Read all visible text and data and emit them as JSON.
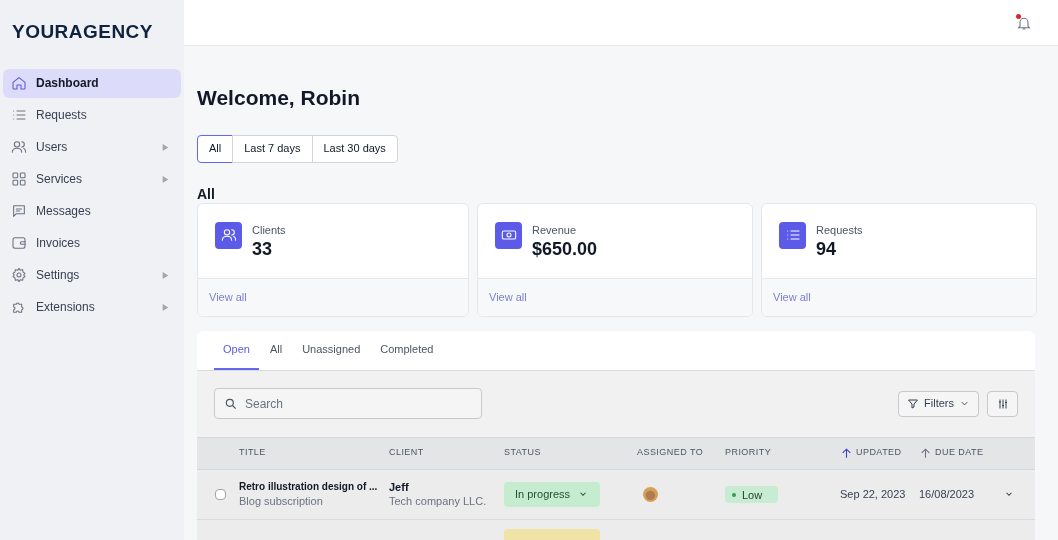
{
  "sidebar": {
    "logo": "YOURAGENCY",
    "items": [
      {
        "label": "Dashboard",
        "selected": true,
        "submenu": false
      },
      {
        "label": "Requests",
        "selected": false,
        "submenu": false
      },
      {
        "label": "Users",
        "selected": false,
        "submenu": true
      },
      {
        "label": "Services",
        "selected": false,
        "submenu": true
      },
      {
        "label": "Messages",
        "selected": false,
        "submenu": false
      },
      {
        "label": "Invoices",
        "selected": false,
        "submenu": false
      },
      {
        "label": "Settings",
        "selected": false,
        "submenu": true
      },
      {
        "label": "Extensions",
        "selected": false,
        "submenu": true
      }
    ]
  },
  "header": {
    "notification": true
  },
  "title": "Welcome, Robin",
  "ranges": [
    {
      "label": "All",
      "selected": true
    },
    {
      "label": "Last 7 days",
      "selected": false
    },
    {
      "label": "Last 30 days",
      "selected": false
    }
  ],
  "section_title": "All",
  "stats": [
    {
      "label": "Clients",
      "value": "33",
      "link": "View all"
    },
    {
      "label": "Revenue",
      "value": "$650.00",
      "link": "View all"
    },
    {
      "label": "Requests",
      "value": "94",
      "link": "View all"
    }
  ],
  "tabs": [
    {
      "label": "Open",
      "selected": true
    },
    {
      "label": "All",
      "selected": false
    },
    {
      "label": "Unassigned",
      "selected": false
    },
    {
      "label": "Completed",
      "selected": false
    }
  ],
  "search": {
    "placeholder": "Search"
  },
  "filters_button": "Filters",
  "table": {
    "columns": [
      {
        "label": "TITLE"
      },
      {
        "label": "CLIENT"
      },
      {
        "label": "STATUS"
      },
      {
        "label": "ASSIGNED TO"
      },
      {
        "label": "PRIORITY"
      },
      {
        "label": "UPDATED",
        "sorted": true
      },
      {
        "label": "DUE DATE",
        "sorted": false
      }
    ],
    "rows": [
      {
        "title": "Retro illustration design of ...",
        "subtitle": "Blog subscription",
        "client": "Jeff",
        "company": "Tech company LLC.",
        "status": "In progress",
        "color": "#c6ecd0",
        "checked": false,
        "priority": "Low",
        "updated": "Sep 22, 2023",
        "due": "16/08/2023"
      },
      {
        "color": "#efe4a6"
      }
    ]
  }
}
